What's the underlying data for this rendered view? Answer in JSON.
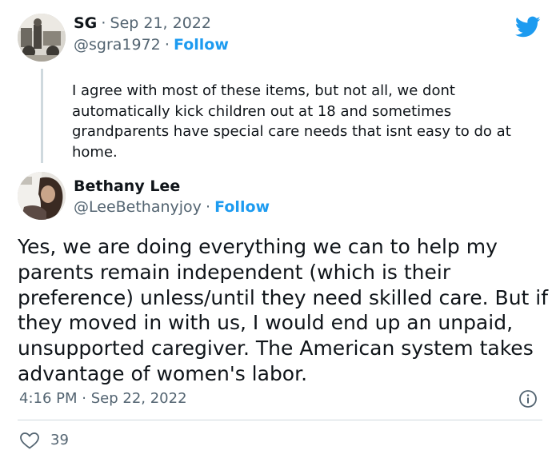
{
  "colors": {
    "link": "#1d9bf0",
    "secondary_text": "#536471",
    "primary_text": "#0f1419",
    "divider": "#cfd9de"
  },
  "reply_tweet": {
    "name": "SG",
    "date": "Sep 21, 2022",
    "handle": "@sgra1972",
    "follow_label": "Follow",
    "text": "I agree with most of these items, but not all, we dont automatically kick children out at 18 and sometimes grandparents have special care needs that isnt easy to do at home."
  },
  "main_tweet": {
    "name": "Bethany Lee",
    "handle": "@LeeBethanyjoy",
    "follow_label": "Follow",
    "text": "Yes, we are doing everything we can to help my parents remain independent (which is their preference) unless/until they need skilled care. But if they moved in with us, I would end up an unpaid, unsupported caregiver. The American system takes advantage of women's labor.",
    "time": "4:16 PM",
    "date": "Sep 22, 2022",
    "like_count": "39"
  },
  "separator": "·",
  "icons": {
    "logo": "twitter-bird-icon",
    "info": "info-icon",
    "like": "heart-icon"
  }
}
